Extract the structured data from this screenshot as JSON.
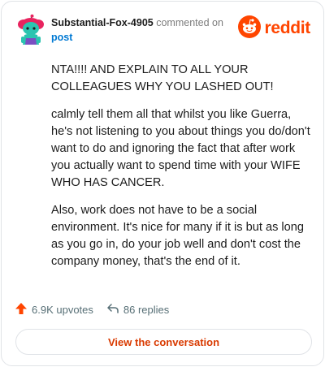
{
  "header": {
    "author": "Substantial-Fox-4905",
    "action": "commented on",
    "target": "post",
    "logo_text": "reddit"
  },
  "comment": {
    "paragraphs": [
      "NTA!!!! AND EXPLAIN TO ALL YOUR COLLEAGUES WHY YOU LASHED OUT!",
      "calmly tell them all that whilst you like Guerra, he's not listening to you about things you do/don't want to do and ignoring the fact that after work you actually want to spend time with your WIFE WHO HAS CANCER.",
      "Also, work does not have to be a social environment. It's nice for many if it is but as long as you go in, do your job well and don't cost the company money, that's the end of it."
    ]
  },
  "footer": {
    "upvotes": "6.9K upvotes",
    "replies": "86 replies",
    "view_button": "View the conversation"
  },
  "colors": {
    "brand": "#ff4500",
    "link": "#0079d3",
    "button_text": "#d93a00",
    "muted": "#576f76"
  },
  "icons": [
    "snoo-avatar-icon",
    "reddit-logo-icon",
    "upvote-arrow-icon",
    "reply-arrow-icon"
  ]
}
